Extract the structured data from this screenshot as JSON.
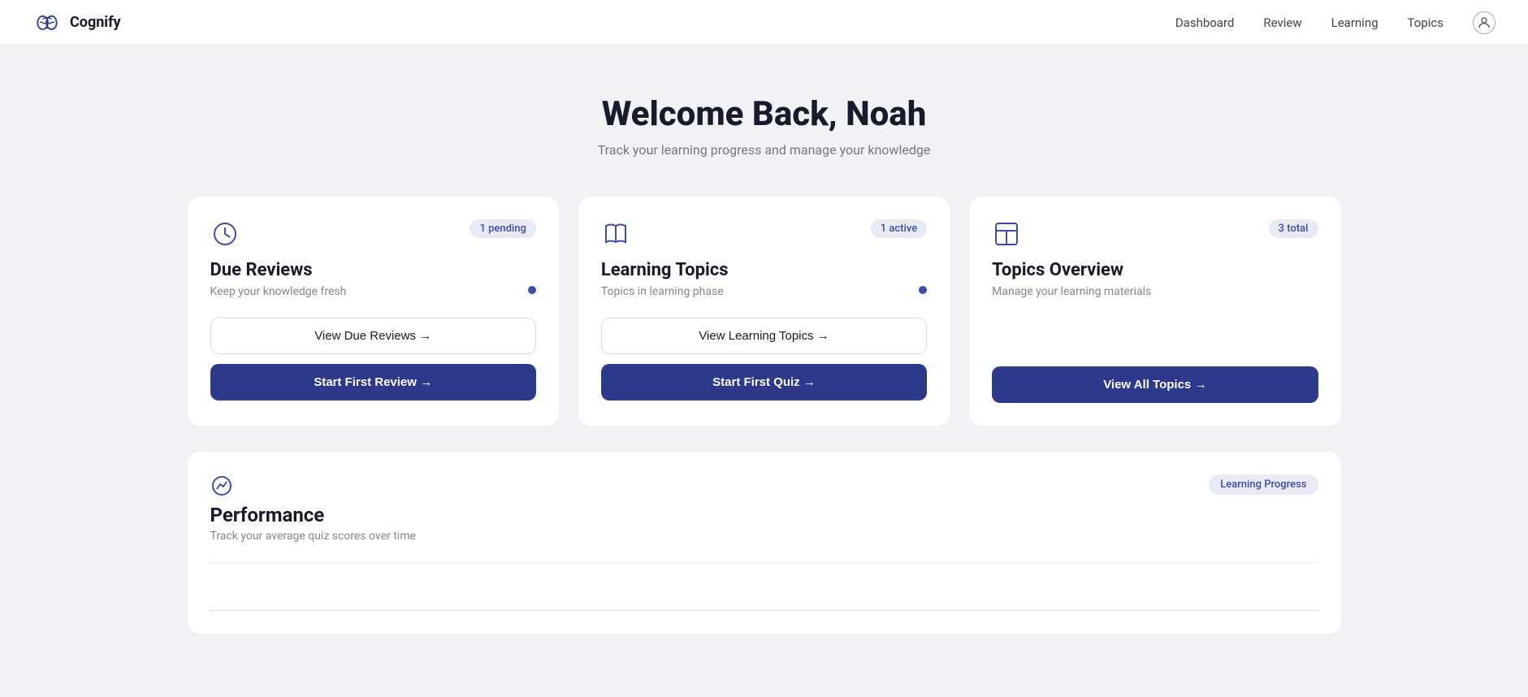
{
  "brand": {
    "name": "Cognify"
  },
  "navbar": {
    "links": [
      {
        "id": "dashboard",
        "label": "Dashboard"
      },
      {
        "id": "review",
        "label": "Review"
      },
      {
        "id": "learning",
        "label": "Learning"
      },
      {
        "id": "topics",
        "label": "Topics"
      }
    ]
  },
  "hero": {
    "title": "Welcome Back, Noah",
    "subtitle": "Track your learning progress and manage your knowledge"
  },
  "cards": [
    {
      "id": "due-reviews",
      "icon": "clock-icon",
      "badge": "1 pending",
      "title": "Due Reviews",
      "subtitle": "Keep your knowledge fresh",
      "outline_btn": "View Due Reviews →",
      "primary_btn": "Start First Review →"
    },
    {
      "id": "learning-topics",
      "icon": "book-icon",
      "badge": "1 active",
      "title": "Learning Topics",
      "subtitle": "Topics in learning phase",
      "outline_btn": "View Learning Topics →",
      "primary_btn": "Start First Quiz →"
    },
    {
      "id": "topics-overview",
      "icon": "layout-icon",
      "badge": "3 total",
      "title": "Topics Overview",
      "subtitle": "Manage your learning materials",
      "primary_btn": "View All Topics →"
    }
  ],
  "performance": {
    "icon": "chart-icon",
    "badge": "Learning Progress",
    "title": "Performance",
    "subtitle": "Track your average quiz scores over time"
  }
}
